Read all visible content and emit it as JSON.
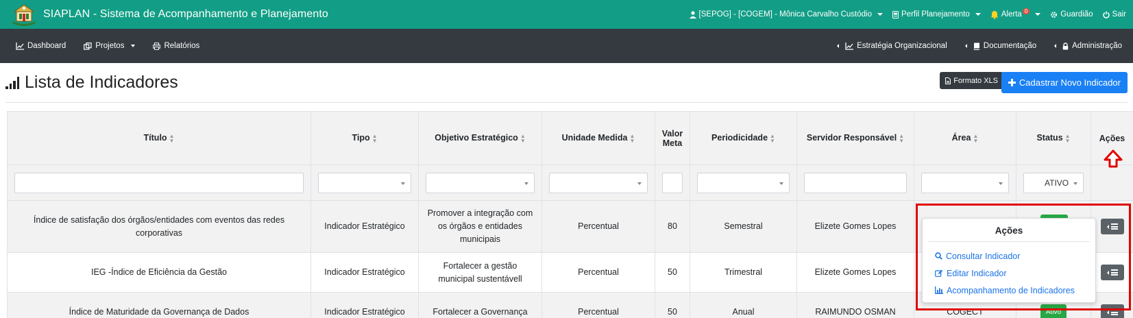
{
  "topbar": {
    "app_title": "SIAPLAN - Sistema de Acompanhamento e Planejamento",
    "user": "[SEPOG] - [COGEM] - Mônica Carvalho Custódio",
    "profile": "Perfil Planejamento",
    "alert": "Alerta",
    "alert_count": "0",
    "guardian": "Guardião",
    "exit": "Sair"
  },
  "navbar": {
    "dashboard": "Dashboard",
    "projects": "Projetos",
    "reports": "Relatórios",
    "strategy": "Estratégia Organizacional",
    "docs": "Documentação",
    "admin": "Administração"
  },
  "page": {
    "title": "Lista de Indicadores",
    "xls_button": "Formato XLS",
    "new_button": "Cadastrar Novo Indicador"
  },
  "table": {
    "headers": {
      "titulo": "Título",
      "tipo": "Tipo",
      "objetivo": "Objetivo Estratégico",
      "unidade": "Unidade Medida",
      "valor_meta": "Valor Meta",
      "periodicidade": "Periodicidade",
      "servidor": "Servidor Responsável",
      "area": "Área",
      "status": "Status",
      "acoes": "Ações"
    },
    "status_filter": "ATIVO",
    "rows": [
      {
        "titulo": "Índice de satisfação dos órgãos/entidades com eventos das redes corporativas",
        "tipo": "Indicador Estratégico",
        "objetivo": "Promover a integração com os órgãos e entidades municipais",
        "unidade": "Percentual",
        "valor_meta": "80",
        "periodicidade": "Semestral",
        "servidor": "Elizete Gomes Lopes",
        "area": "",
        "status": ""
      },
      {
        "titulo": "IEG -Índice de Eficiência da Gestão",
        "tipo": "Indicador Estratégico",
        "objetivo": "Fortalecer a gestão municipal sustentávell",
        "unidade": "Percentual",
        "valor_meta": "50",
        "periodicidade": "Trimestral",
        "servidor": "Elizete Gomes Lopes",
        "area": "",
        "status": ""
      },
      {
        "titulo": "Índice de Maturidade da Governança de Dados",
        "tipo": "Indicador Estratégico",
        "objetivo": "Fortalecer a Governança",
        "unidade": "Percentual",
        "valor_meta": "50",
        "periodicidade": "Anual",
        "servidor": "RAIMUNDO OSMAN",
        "area": "COGECT",
        "status": "Ativo"
      }
    ]
  },
  "actions_menu": {
    "title": "Ações",
    "consult": "Consultar Indicador",
    "edit": "Editar Indicador",
    "follow": "Acompanhamento de Indicadores"
  },
  "colors": {
    "topbar": "#129e86",
    "navbar": "#343a40",
    "primary": "#1a80f5",
    "highlight": "#e00000",
    "success": "#28a745"
  }
}
